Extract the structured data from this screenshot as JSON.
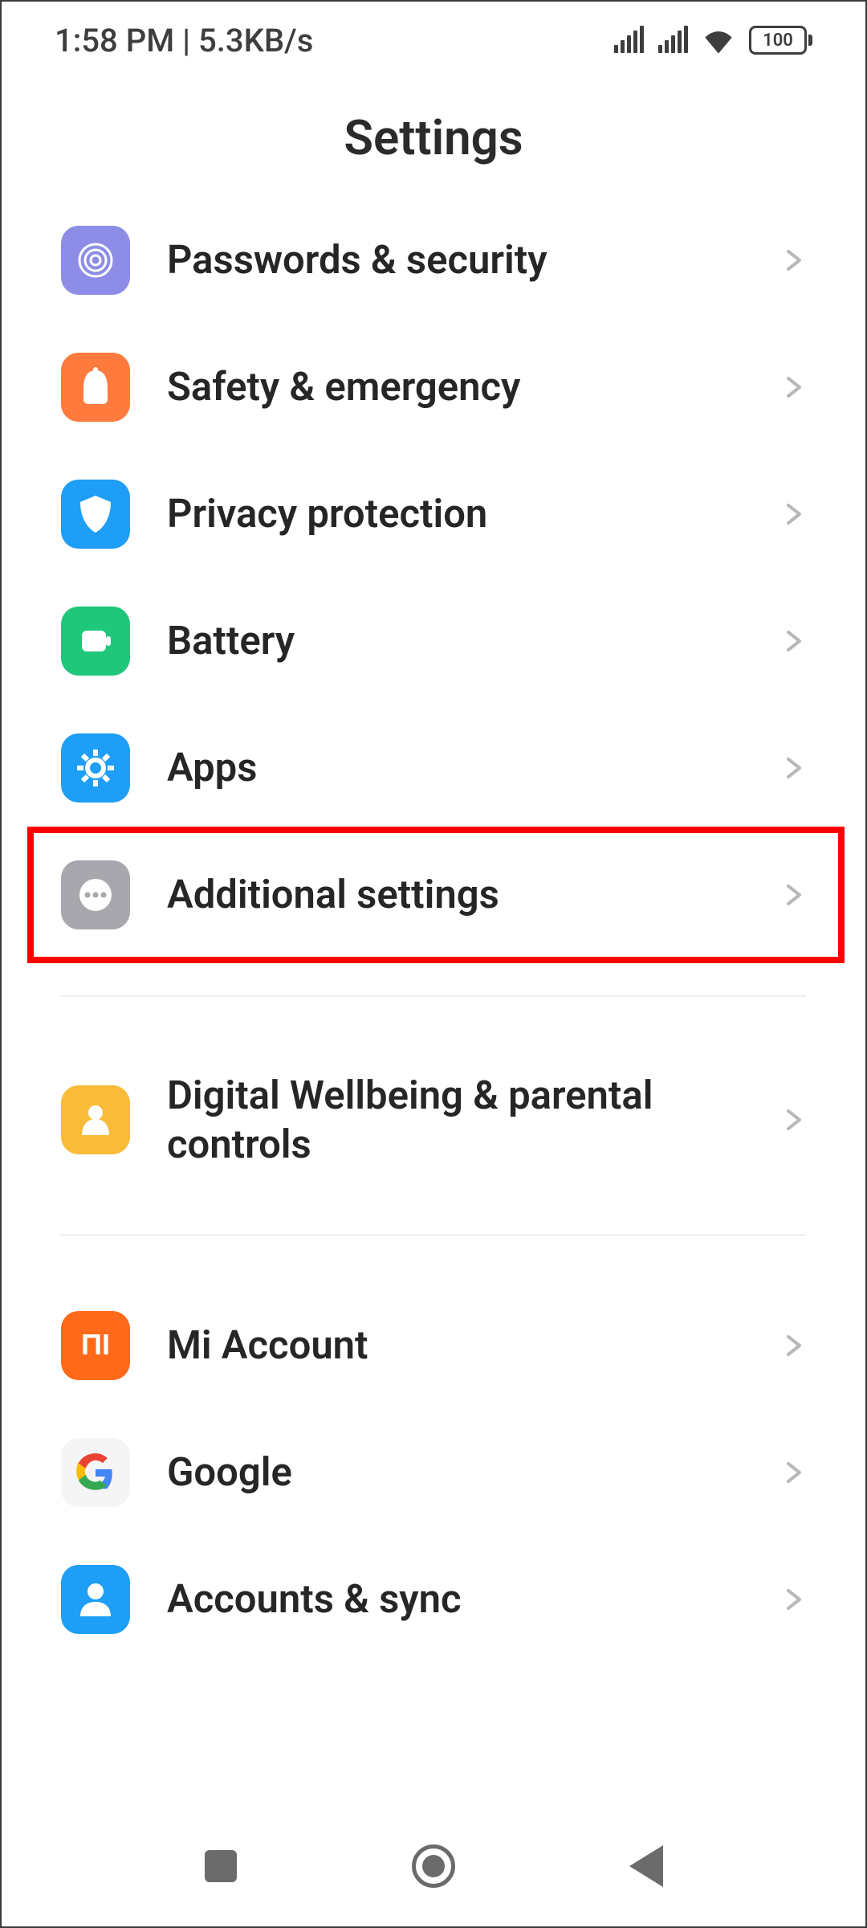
{
  "status_bar": {
    "time": "1:58 PM",
    "net_speed": "5.3KB/s",
    "battery_pct": "100"
  },
  "header": {
    "title": "Settings"
  },
  "items": [
    {
      "label": "Passwords & security",
      "icon": "fingerprint-icon",
      "bg": "bg-purple",
      "highlighted": false
    },
    {
      "label": "Safety & emergency",
      "icon": "sos-icon",
      "bg": "bg-orange",
      "highlighted": false
    },
    {
      "label": "Privacy protection",
      "icon": "shield-icon",
      "bg": "bg-blue",
      "highlighted": false
    },
    {
      "label": "Battery",
      "icon": "battery-icon",
      "bg": "bg-green",
      "highlighted": false
    },
    {
      "label": "Apps",
      "icon": "gear-icon",
      "bg": "bg-blue2",
      "highlighted": false
    },
    {
      "label": "Additional settings",
      "icon": "dots-icon",
      "bg": "bg-grey",
      "highlighted": true
    },
    {
      "__divider": true
    },
    {
      "label": "Digital Wellbeing & parental controls",
      "icon": "wellbeing-icon",
      "bg": "bg-amber",
      "highlighted": false
    },
    {
      "__divider": true
    },
    {
      "label": "Mi Account",
      "icon": "mi-icon",
      "bg": "bg-miorange",
      "highlighted": false
    },
    {
      "label": "Google",
      "icon": "google-icon",
      "bg": "google-g",
      "highlighted": false
    },
    {
      "label": "Accounts & sync",
      "icon": "person-icon",
      "bg": "bg-blue3",
      "highlighted": false
    }
  ]
}
